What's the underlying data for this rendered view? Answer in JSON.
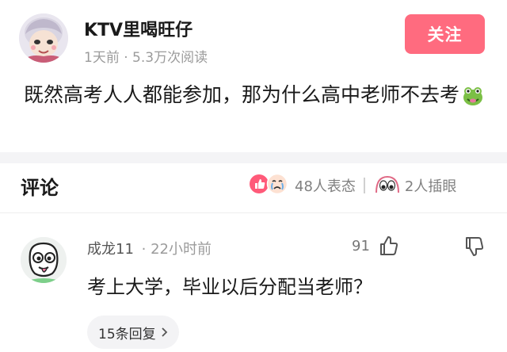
{
  "post": {
    "author": "KTV里喝旺仔",
    "meta": "1天前 · 5.3万次阅读",
    "follow_label": "关注",
    "text": "既然高考人人都能参加，那为什么高中老师不去考"
  },
  "comments": {
    "title": "评论",
    "reactions_text": "48人表态",
    "insert_eye_text": "2人插眼",
    "item": {
      "user": "成龙11",
      "time": "· 22小时前",
      "likes": "91",
      "text": "考上大学，毕业以后分配当老师？",
      "replies": "15条回复"
    }
  },
  "colors": {
    "follow_bg": "#ff6b7f",
    "muted": "#9b9b9b",
    "divider": "#f4f4f6"
  },
  "icons": [
    "anime-avatar-icon",
    "frog-emoji-icon",
    "like-reaction-icon",
    "crying-face-icon",
    "peeking-eyes-icon",
    "cartoon-face-avatar-icon",
    "thumbs-up-icon",
    "thumbs-down-icon",
    "chevron-right-icon"
  ]
}
